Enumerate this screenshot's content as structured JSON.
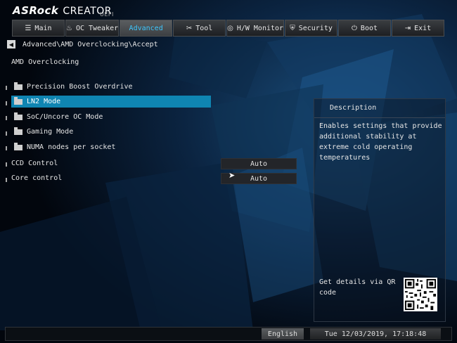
{
  "brand": {
    "name": "ASRock",
    "product": "CREATOR",
    "suffix": "UEFI"
  },
  "tabs": [
    {
      "label": "Main",
      "icon": "list-icon"
    },
    {
      "label": "OC Tweaker",
      "icon": "flame-icon"
    },
    {
      "label": "Advanced",
      "icon": "",
      "active": true
    },
    {
      "label": "Tool",
      "icon": "tools-icon"
    },
    {
      "label": "H/W Monitor",
      "icon": "monitor-icon"
    },
    {
      "label": "Security",
      "icon": "shield-icon"
    },
    {
      "label": "Boot",
      "icon": "power-icon"
    },
    {
      "label": "Exit",
      "icon": "exit-icon"
    }
  ],
  "breadcrumb": "Advanced\\AMD Overclocking\\Accept",
  "section_title": "AMD Overclocking",
  "menu_items": [
    {
      "label": "Precision Boost Overdrive"
    },
    {
      "label": "LN2 Mode",
      "selected": true
    },
    {
      "label": "SoC/Uncore OC Mode"
    },
    {
      "label": "Gaming Mode"
    },
    {
      "label": "NUMA nodes per socket"
    }
  ],
  "settings": [
    {
      "label": "CCD Control",
      "value": "Auto"
    },
    {
      "label": "Core control",
      "value": "Auto"
    }
  ],
  "description": {
    "title": "Description",
    "text": "Enables settings that provide additional stability at extreme cold operating temperatures",
    "qr_text": "Get details via QR code"
  },
  "footer": {
    "language": "English",
    "datetime": "Tue 12/03/2019, 17:18:48"
  },
  "colors": {
    "accent": "#3fc8ff",
    "selection": "#0f85b2"
  }
}
